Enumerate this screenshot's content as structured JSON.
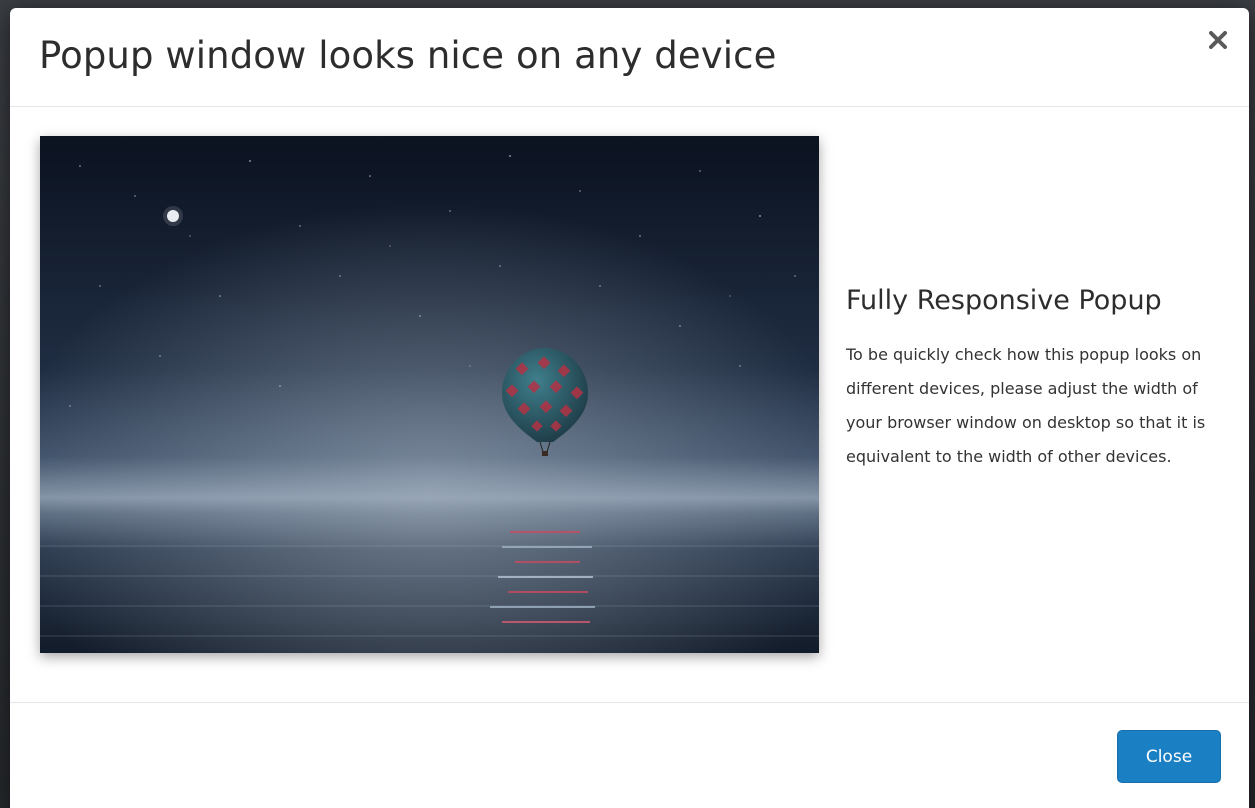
{
  "modal": {
    "title": "Popup window looks nice on any device",
    "close_icon": "close-icon",
    "image": {
      "semantic": "hot-air-balloon-over-night-sea-photo"
    },
    "side": {
      "title": "Fully Responsive Popup",
      "text": "To be quickly check how this popup looks on different devices, please adjust the width of your browser window on desktop so that it is equivalent to the width of other devices."
    },
    "footer": {
      "close_label": "Close"
    }
  },
  "colors": {
    "accent": "#1a7fc3",
    "title_text": "#2d2d2d",
    "body_text": "#333333",
    "divider": "#e5e5e5"
  }
}
